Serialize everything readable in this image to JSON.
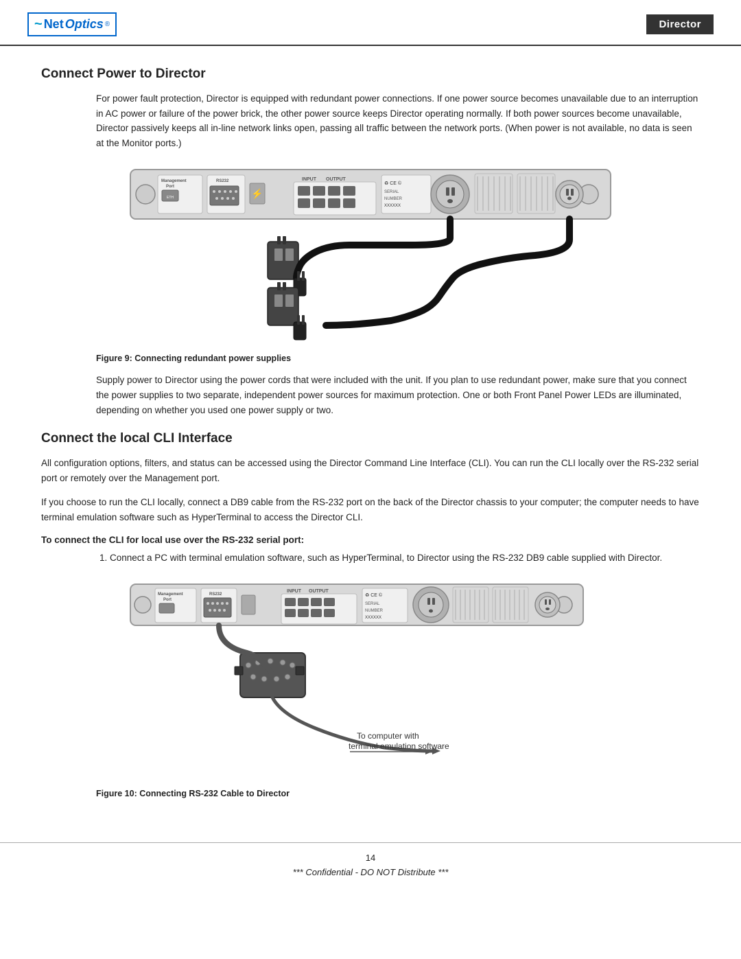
{
  "header": {
    "logo_net": "Net",
    "logo_optics": "Optics",
    "logo_reg": "®",
    "director_label": "Director"
  },
  "section1": {
    "title": "Connect Power to Director",
    "para1": "For power fault protection, Director is equipped with redundant power connections. If one power source becomes unavailable due to an interruption in AC power or failure of the power brick, the other power source keeps Director operating normally. If both power sources become unavailable, Director passively keeps all in-line network links open, passing all traffic between the network ports. (When power is not available, no data is seen at the Monitor ports.)",
    "figure9_caption": "Figure 9: Connecting redundant power supplies",
    "para2": "Supply power to Director using the power cords that were included with the unit. If you plan to use redundant power, make sure that you connect the power supplies to two separate, independent power sources for maximum protection. One or both Front Panel Power LEDs are illuminated, depending on whether you used one power supply or two."
  },
  "section2": {
    "title": "Connect the local CLI Interface",
    "para1": "All configuration options, filters, and status can be accessed using the Director Command Line Interface (CLI). You can run the CLI locally over the RS-232 serial port or remotely over the Management port.",
    "para2": "If you choose to run the CLI locally, connect a DB9 cable from the RS-232 port on the back of the Director chassis to your computer; the computer needs to have terminal emulation software such as HyperTerminal to access the Director CLI.",
    "bold_label": "To connect the CLI for local use over the RS-232 serial port:",
    "list_item1": "Connect a PC with terminal emulation software, such as HyperTerminal, to Director using the RS-232 DB9 cable supplied with Director.",
    "figure10_caption": "Figure 10: Connecting RS-232 Cable to Director",
    "to_computer_label": "To computer with\nterminal emulation software"
  },
  "footer": {
    "page_number": "14",
    "confidential": "*** Confidential - DO NOT Distribute ***"
  }
}
